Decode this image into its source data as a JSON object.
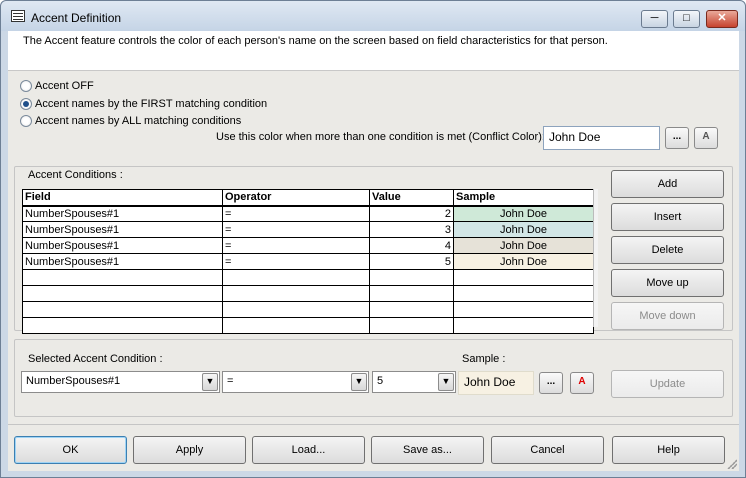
{
  "window": {
    "title": "Accent Definition"
  },
  "description": "The Accent feature controls the color of each person's name on the screen based on field characteristics for that person.",
  "modes": {
    "off_label": "Accent OFF",
    "first_label": "Accent names by the FIRST matching condition",
    "all_label": "Accent names by ALL matching conditions",
    "selected": "first"
  },
  "conflict": {
    "label": "Use this color when more than one condition is met (Conflict Color):",
    "sample_text": "John Doe",
    "browse_label": "...",
    "font_label": "A"
  },
  "conditions": {
    "group_title": "Accent Conditions :",
    "columns": [
      "Field",
      "Operator",
      "Value",
      "Sample"
    ],
    "rows": [
      {
        "field": "NumberSpouses#1",
        "operator": "=",
        "value": "2",
        "sample": "John Doe",
        "color": "#cfe9d8"
      },
      {
        "field": "NumberSpouses#1",
        "operator": "=",
        "value": "3",
        "sample": "John Doe",
        "color": "#d2e6e6"
      },
      {
        "field": "NumberSpouses#1",
        "operator": "=",
        "value": "4",
        "sample": "John Doe",
        "color": "#e6e2d8"
      },
      {
        "field": "NumberSpouses#1",
        "operator": "=",
        "value": "5",
        "sample": "John Doe",
        "color": "#f7f1e3"
      }
    ]
  },
  "side_buttons": {
    "add": "Add",
    "insert": "Insert",
    "delete": "Delete",
    "move_up": "Move up",
    "move_down": "Move down"
  },
  "selected": {
    "group_title": "Selected Accent Condition :",
    "field": "NumberSpouses#1",
    "operator": "=",
    "value": "5",
    "sample_label": "Sample :",
    "sample_text": "John Doe",
    "sample_color": "#f7f1e3",
    "browse_label": "...",
    "font_label": "A",
    "update": "Update"
  },
  "footer": {
    "ok": "OK",
    "apply": "Apply",
    "load": "Load...",
    "save_as": "Save as...",
    "cancel": "Cancel",
    "help": "Help"
  }
}
